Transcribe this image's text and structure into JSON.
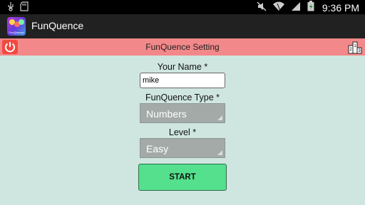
{
  "status_bar": {
    "icons": [
      "usb-icon",
      "sd-card-icon",
      "mute-icon",
      "wifi-icon",
      "signal-icon",
      "battery-charging-icon"
    ],
    "time": "9:36 PM"
  },
  "action_bar": {
    "app_icon_text": "FunQuence",
    "title": "FunQuence"
  },
  "setting_bar": {
    "title": "FunQuence Setting",
    "rank_digits": [
      "1",
      "2",
      "3"
    ],
    "color": "#f3888a"
  },
  "form": {
    "name_label": "Your Name *",
    "name_value": "mike",
    "type_label": "FunQuence Type *",
    "type_value": "Numbers",
    "level_label": "Level *",
    "level_value": "Easy",
    "start_label": "START"
  },
  "colors": {
    "background": "#cfe6e0",
    "start_button": "#54e08d",
    "power_button": "#f04a40"
  }
}
